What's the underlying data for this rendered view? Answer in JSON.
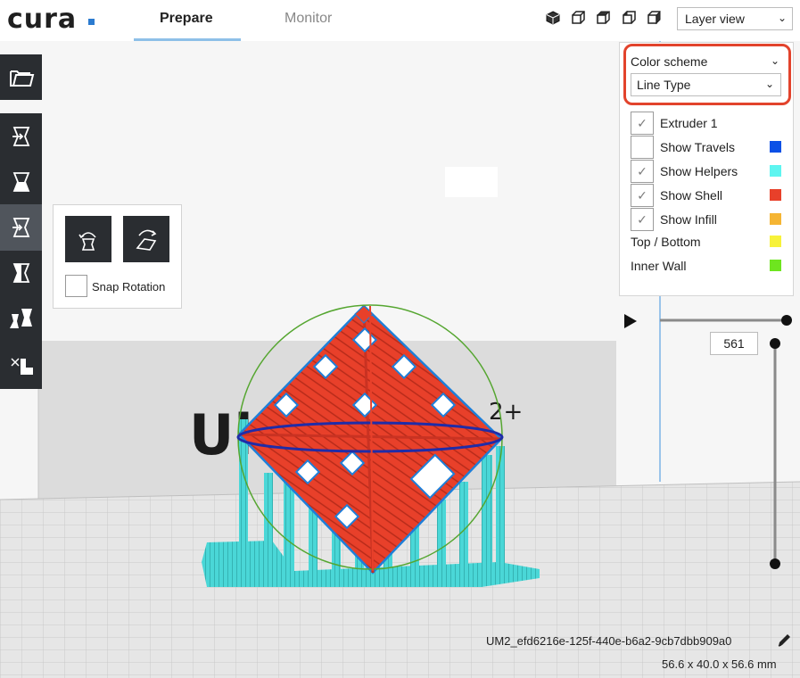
{
  "app": {
    "logo_text": "cura",
    "accent_color": "#2b7bd0"
  },
  "header": {
    "tabs": [
      {
        "label": "Prepare",
        "active": true
      },
      {
        "label": "Monitor",
        "active": false
      }
    ],
    "view_icons": [
      "3d-view-icon",
      "front-view-icon",
      "top-view-icon",
      "left-view-icon",
      "right-view-icon"
    ],
    "view_mode": "Layer view"
  },
  "toolbar": {
    "items": [
      {
        "name": "open-file",
        "icon": "folder-icon"
      },
      {
        "name": "move-tool",
        "icon": "move-icon"
      },
      {
        "name": "scale-tool",
        "icon": "scale-icon"
      },
      {
        "name": "rotate-tool",
        "icon": "rotate-icon",
        "active": true
      },
      {
        "name": "mirror-tool",
        "icon": "mirror-icon"
      },
      {
        "name": "per-model-settings",
        "icon": "per-model-settings-icon"
      },
      {
        "name": "support-blocker",
        "icon": "support-blocker-icon"
      }
    ]
  },
  "rotate_panel": {
    "buttons": [
      "reset-rotation-icon",
      "lay-flat-icon"
    ],
    "snap_label": "Snap Rotation",
    "snap_checked": false
  },
  "layer_panel": {
    "color_scheme_label": "Color scheme",
    "color_scheme_value": "Line Type",
    "legend": [
      {
        "label": "Extruder 1",
        "checkbox": true,
        "checked": true,
        "color": null
      },
      {
        "label": "Show Travels",
        "checkbox": true,
        "checked": false,
        "color": "#0a50e6"
      },
      {
        "label": "Show Helpers",
        "checkbox": true,
        "checked": true,
        "color": "#5ef5f0"
      },
      {
        "label": "Show Shell",
        "checkbox": true,
        "checked": true,
        "color": "#e8402a"
      },
      {
        "label": "Show Infill",
        "checkbox": true,
        "checked": true,
        "color": "#f5b533"
      },
      {
        "label": "Top / Bottom",
        "checkbox": false,
        "color": "#f7f23a"
      },
      {
        "label": "Inner Wall",
        "checkbox": false,
        "color": "#6ee51f"
      }
    ]
  },
  "layer_slider": {
    "current_layer": "561"
  },
  "build_plate_text": {
    "brand": "Ultima",
    "suffix": "2+"
  },
  "job": {
    "name": "UM2_efd6216e-125f-440e-b6a2-9cb7dbb909a0",
    "dimensions": "56.6 x 40.0 x 56.6 mm"
  },
  "colors": {
    "toolbar_bg": "#2a2d31",
    "shell": "#e8402a",
    "helpers": "#5ef5f0",
    "highlight": "#e2432c"
  }
}
